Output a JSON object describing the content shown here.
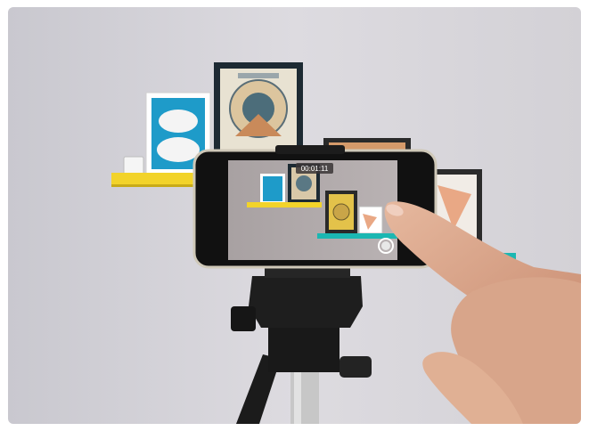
{
  "photo": {
    "recording_timer": "00:01:11",
    "colors": {
      "wall": "#d6d4d9",
      "shelf_yellow": "#f2d32a",
      "shelf_teal": "#1bb7b2",
      "poster_blue": "#1e9bc9",
      "phone_body": "#111111",
      "phone_rim": "#cfc8b8",
      "tripod": "#1b1b1b",
      "skin": "#d9a98e"
    }
  }
}
